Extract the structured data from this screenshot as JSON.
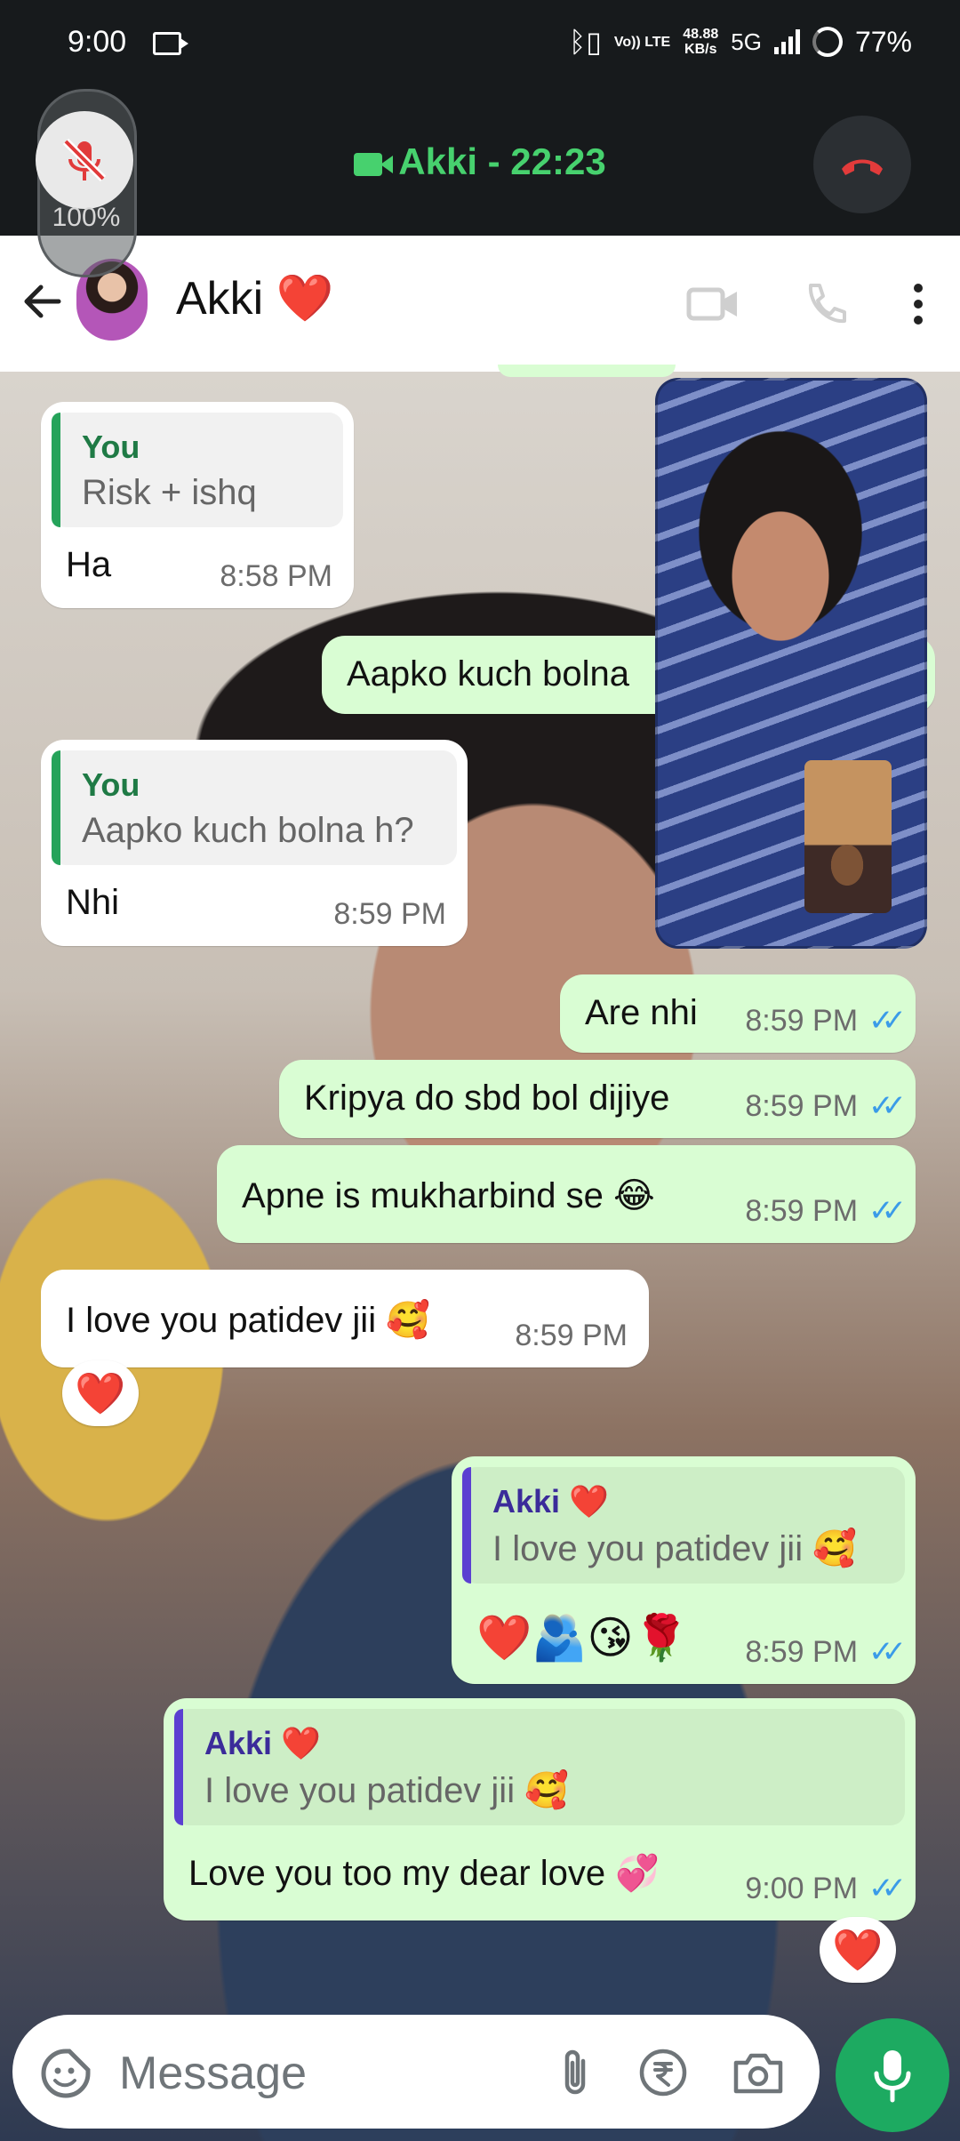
{
  "status_bar": {
    "time": "9:00",
    "network_speed_value": "48.88",
    "network_speed_unit": "KB/s",
    "volte_label": "Vo)) LTE",
    "network": "5G",
    "battery": "77%"
  },
  "call": {
    "title": "Akki - 22:23",
    "volume_percent": "100%"
  },
  "header": {
    "contact_name": "Akki",
    "contact_emoji": "❤️"
  },
  "messages": [
    {
      "direction": "in",
      "quote_author": "You",
      "quote_text": "Risk + ishq",
      "text": "Ha",
      "time": "8:58 PM"
    },
    {
      "direction": "out",
      "text": "Aapko kuch bolna",
      "time": ""
    },
    {
      "direction": "in",
      "quote_author": "You",
      "quote_text": "Aapko kuch bolna h?",
      "text": "Nhi",
      "time": "8:59 PM"
    },
    {
      "direction": "out",
      "text": "Are nhi",
      "time": "8:59 PM"
    },
    {
      "direction": "out",
      "text": "Kripya do sbd bol dijiye",
      "time": "8:59 PM"
    },
    {
      "direction": "out",
      "text": "Apne is mukharbind se 😂",
      "time": "8:59 PM"
    },
    {
      "direction": "in",
      "text": "I love you patidev jii 🥰",
      "time": "8:59 PM",
      "reaction": "❤️"
    },
    {
      "direction": "out",
      "quote_author": "Akki ❤️",
      "quote_text": "I love you patidev jii 🥰",
      "text": "❤️🫂😘🌹",
      "time": "8:59 PM"
    },
    {
      "direction": "out",
      "quote_author": "Akki ❤️",
      "quote_text": "I love you patidev jii 🥰",
      "text": "Love you too my dear love 💞",
      "time": "9:00 PM",
      "reaction": "❤️"
    }
  ],
  "input": {
    "placeholder": "Message"
  },
  "colors": {
    "call_green": "#47d16e",
    "end_call_red": "#e23b3b",
    "outgoing_bubble": "#d9fdd3",
    "mic_button": "#1daa61",
    "read_ticks": "#3b9be8"
  },
  "icons": [
    "back-arrow-icon",
    "video-call-icon",
    "voice-call-icon",
    "more-options-icon",
    "sticker-icon",
    "attach-icon",
    "rupee-icon",
    "camera-icon",
    "mic-icon",
    "mute-mic-icon",
    "end-call-icon"
  ]
}
